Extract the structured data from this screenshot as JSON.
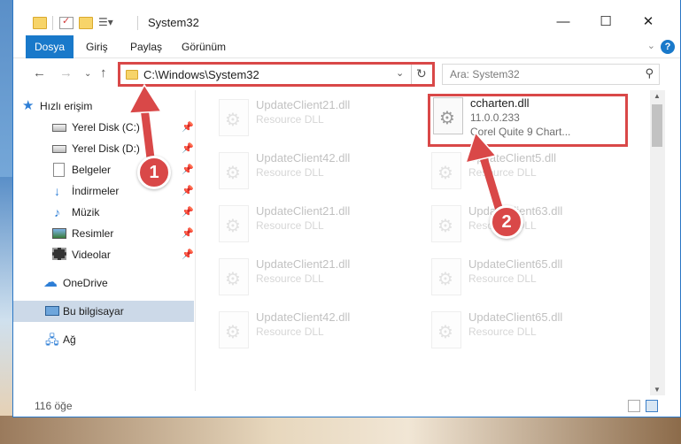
{
  "window": {
    "title": "System32",
    "controls": {
      "minimize": "—",
      "maximize": "☐",
      "close": "✕"
    }
  },
  "ribbon": {
    "tabs": [
      {
        "label": "Dosya",
        "active": true
      },
      {
        "label": "Giriş"
      },
      {
        "label": "Paylaş"
      },
      {
        "label": "Görünüm"
      }
    ],
    "help": "?"
  },
  "address": {
    "path": "C:\\Windows\\System32",
    "search_placeholder": "Ara: System32"
  },
  "sidebar": {
    "items": [
      {
        "label": "Hızlı erişim",
        "icon": "star-icon"
      },
      {
        "label": "Yerel Disk (C:)",
        "icon": "drive-icon",
        "pinned": true
      },
      {
        "label": "Yerel Disk (D:)",
        "icon": "drive-icon",
        "pinned": true
      },
      {
        "label": "Belgeler",
        "icon": "document-icon",
        "pinned": true
      },
      {
        "label": "İndirmeler",
        "icon": "download-icon",
        "pinned": true
      },
      {
        "label": "Müzik",
        "icon": "music-icon",
        "pinned": true
      },
      {
        "label": "Resimler",
        "icon": "pictures-icon",
        "pinned": true
      },
      {
        "label": "Videolar",
        "icon": "videos-icon",
        "pinned": true
      },
      {
        "label": "OneDrive",
        "icon": "cloud-icon"
      },
      {
        "label": "Bu bilgisayar",
        "icon": "computer-icon",
        "selected": true
      },
      {
        "label": "Ağ",
        "icon": "network-icon"
      }
    ]
  },
  "files": {
    "left_column": [
      {
        "name": "UpdateClient21.dll",
        "type": "Resource DLL"
      },
      {
        "name": "UpdateClient42.dll",
        "type": "Resource DLL"
      },
      {
        "name": "UpdateClient21.dll",
        "type": "Resource DLL"
      },
      {
        "name": "UpdateClient21.dll",
        "type": "Resource DLL"
      },
      {
        "name": "UpdateClient42.dll",
        "type": "Resource DLL"
      }
    ],
    "highlighted": {
      "name": "ccharten.dll",
      "version": "11.0.0.233",
      "description": "Corel Quite 9 Chart..."
    },
    "right_column": [
      {
        "name": "UpdateClient5.dll",
        "type": "Resource DLL"
      },
      {
        "name": "UpdateClient63.dll",
        "type": "Resource DLL"
      },
      {
        "name": "UpdateClient65.dll",
        "type": "Resource DLL"
      },
      {
        "name": "UpdateClient65.dll",
        "type": "Resource DLL"
      }
    ]
  },
  "status": {
    "count": "116 öğe"
  },
  "annotations": {
    "step1": "1",
    "step2": "2"
  },
  "colors": {
    "accent": "#1979ca",
    "annotation": "#d94848"
  }
}
